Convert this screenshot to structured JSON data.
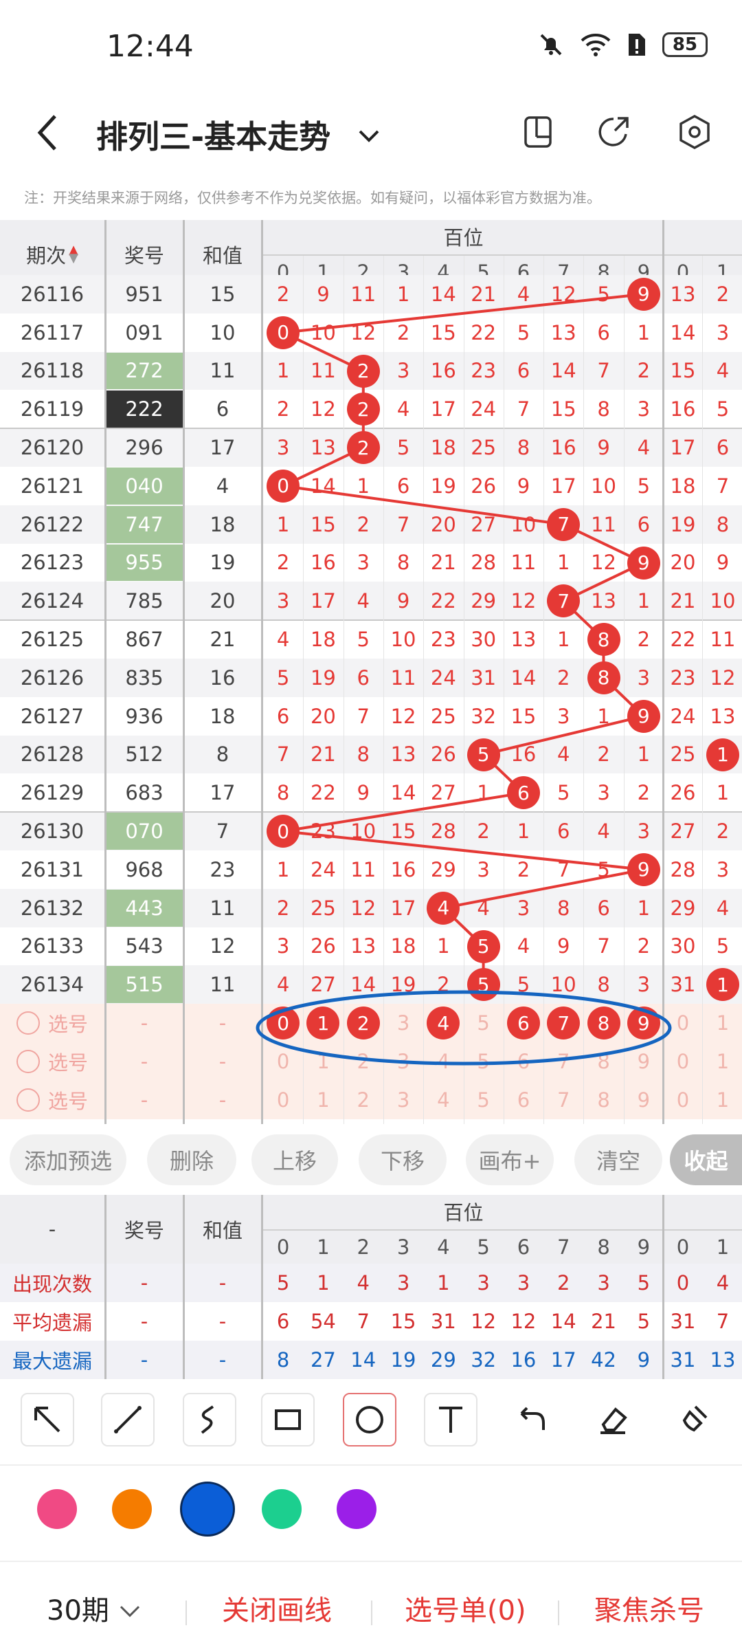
{
  "status": {
    "time": "12:44",
    "battery": "85"
  },
  "header": {
    "title": "排列三-基本走势"
  },
  "note": "注：开奖结果来源于网络，仅供参考不作为兑奖依据。如有疑问，以福体彩官方数据为准。",
  "table": {
    "col_period": "期次",
    "col_number": "奖号",
    "col_sum": "和值",
    "group_label": "百位",
    "digits": [
      "0",
      "1",
      "2",
      "3",
      "4",
      "5",
      "6",
      "7",
      "8",
      "9"
    ],
    "extra_digits": [
      "0",
      "1"
    ],
    "rows": [
      {
        "period": "26116",
        "number": "951",
        "sum": "15",
        "cells": [
          "2",
          "9",
          "11",
          "1",
          "14",
          "21",
          "4",
          "12",
          "5",
          "9"
        ],
        "extra": [
          "13",
          "2"
        ],
        "hit": 9,
        "hl": ""
      },
      {
        "period": "26117",
        "number": "091",
        "sum": "10",
        "cells": [
          "0",
          "10",
          "12",
          "2",
          "15",
          "22",
          "5",
          "13",
          "6",
          "1"
        ],
        "extra": [
          "14",
          "3"
        ],
        "hit": 0,
        "hl": ""
      },
      {
        "period": "26118",
        "number": "272",
        "sum": "11",
        "cells": [
          "1",
          "11",
          "2",
          "3",
          "16",
          "23",
          "6",
          "14",
          "7",
          "2"
        ],
        "extra": [
          "15",
          "4"
        ],
        "hit": 2,
        "hl": "green"
      },
      {
        "period": "26119",
        "number": "222",
        "sum": "6",
        "cells": [
          "2",
          "12",
          "2",
          "4",
          "17",
          "24",
          "7",
          "15",
          "8",
          "3"
        ],
        "extra": [
          "16",
          "5"
        ],
        "hit": 2,
        "hl": "dark"
      },
      {
        "period": "26120",
        "number": "296",
        "sum": "17",
        "cells": [
          "3",
          "13",
          "2",
          "5",
          "18",
          "25",
          "8",
          "16",
          "9",
          "4"
        ],
        "extra": [
          "17",
          "6"
        ],
        "hit": 2,
        "hl": ""
      },
      {
        "period": "26121",
        "number": "040",
        "sum": "4",
        "cells": [
          "0",
          "14",
          "1",
          "6",
          "19",
          "26",
          "9",
          "17",
          "10",
          "5"
        ],
        "extra": [
          "18",
          "7"
        ],
        "hit": 0,
        "hl": "green"
      },
      {
        "period": "26122",
        "number": "747",
        "sum": "18",
        "cells": [
          "1",
          "15",
          "2",
          "7",
          "20",
          "27",
          "10",
          "7",
          "11",
          "6"
        ],
        "extra": [
          "19",
          "8"
        ],
        "hit": 7,
        "hl": "green"
      },
      {
        "period": "26123",
        "number": "955",
        "sum": "19",
        "cells": [
          "2",
          "16",
          "3",
          "8",
          "21",
          "28",
          "11",
          "1",
          "12",
          "9"
        ],
        "extra": [
          "20",
          "9"
        ],
        "hit": 9,
        "hl": "green"
      },
      {
        "period": "26124",
        "number": "785",
        "sum": "20",
        "cells": [
          "3",
          "17",
          "4",
          "9",
          "22",
          "29",
          "12",
          "7",
          "13",
          "1"
        ],
        "extra": [
          "21",
          "10"
        ],
        "hit": 7,
        "hl": ""
      },
      {
        "period": "26125",
        "number": "867",
        "sum": "21",
        "cells": [
          "4",
          "18",
          "5",
          "10",
          "23",
          "30",
          "13",
          "1",
          "8",
          "2"
        ],
        "extra": [
          "22",
          "11"
        ],
        "hit": 8,
        "hl": ""
      },
      {
        "period": "26126",
        "number": "835",
        "sum": "16",
        "cells": [
          "5",
          "19",
          "6",
          "11",
          "24",
          "31",
          "14",
          "2",
          "8",
          "3"
        ],
        "extra": [
          "23",
          "12"
        ],
        "hit": 8,
        "hl": ""
      },
      {
        "period": "26127",
        "number": "936",
        "sum": "18",
        "cells": [
          "6",
          "20",
          "7",
          "12",
          "25",
          "32",
          "15",
          "3",
          "1",
          "9"
        ],
        "extra": [
          "24",
          "13"
        ],
        "hit": 9,
        "hl": ""
      },
      {
        "period": "26128",
        "number": "512",
        "sum": "8",
        "cells": [
          "7",
          "21",
          "8",
          "13",
          "26",
          "5",
          "16",
          "4",
          "2",
          "1"
        ],
        "extra": [
          "25",
          "1"
        ],
        "hit": 5,
        "hl": ""
      },
      {
        "period": "26129",
        "number": "683",
        "sum": "17",
        "cells": [
          "8",
          "22",
          "9",
          "14",
          "27",
          "1",
          "6",
          "5",
          "3",
          "2"
        ],
        "extra": [
          "26",
          "1"
        ],
        "hit": 6,
        "hl": ""
      },
      {
        "period": "26130",
        "number": "070",
        "sum": "7",
        "cells": [
          "0",
          "23",
          "10",
          "15",
          "28",
          "2",
          "1",
          "6",
          "4",
          "3"
        ],
        "extra": [
          "27",
          "2"
        ],
        "hit": 0,
        "hl": "green"
      },
      {
        "period": "26131",
        "number": "968",
        "sum": "23",
        "cells": [
          "1",
          "24",
          "11",
          "16",
          "29",
          "3",
          "2",
          "7",
          "5",
          "9"
        ],
        "extra": [
          "28",
          "3"
        ],
        "hit": 9,
        "hl": ""
      },
      {
        "period": "26132",
        "number": "443",
        "sum": "11",
        "cells": [
          "2",
          "25",
          "12",
          "17",
          "4",
          "4",
          "3",
          "8",
          "6",
          "1"
        ],
        "extra": [
          "29",
          "4"
        ],
        "hit": 4,
        "hl": "green"
      },
      {
        "period": "26133",
        "number": "543",
        "sum": "12",
        "cells": [
          "3",
          "26",
          "13",
          "18",
          "1",
          "5",
          "4",
          "9",
          "7",
          "2"
        ],
        "extra": [
          "30",
          "5"
        ],
        "hit": 5,
        "hl": ""
      },
      {
        "period": "26134",
        "number": "515",
        "sum": "11",
        "cells": [
          "4",
          "27",
          "14",
          "19",
          "2",
          "5",
          "5",
          "10",
          "8",
          "3"
        ],
        "extra": [
          "31",
          "1"
        ],
        "hit": 5,
        "hl": "green"
      }
    ],
    "select_label": "选号",
    "dash": "-",
    "select_row1_marked": [
      0,
      1,
      2,
      4,
      6,
      7,
      8,
      9
    ]
  },
  "actions": [
    "添加预选",
    "删除",
    "上移",
    "下移",
    "画布+",
    "清空",
    "收起"
  ],
  "stats": {
    "head_dash": "-",
    "col_number": "奖号",
    "col_sum": "和值",
    "group_label": "百位",
    "rows": [
      {
        "label": "出现次数",
        "values": [
          "5",
          "1",
          "4",
          "3",
          "1",
          "3",
          "3",
          "2",
          "3",
          "5"
        ],
        "extra": [
          "0",
          "4"
        ],
        "color": "#d32f2f"
      },
      {
        "label": "平均遗漏",
        "values": [
          "6",
          "54",
          "7",
          "15",
          "31",
          "12",
          "12",
          "14",
          "21",
          "5"
        ],
        "extra": [
          "31",
          "7"
        ],
        "color": "#d32f2f"
      },
      {
        "label": "最大遗漏",
        "values": [
          "8",
          "27",
          "14",
          "19",
          "29",
          "32",
          "16",
          "17",
          "42",
          "9"
        ],
        "extra": [
          "31",
          "13"
        ],
        "color": "#1565c0"
      }
    ]
  },
  "tools": [
    "arrow-tool",
    "line-tool",
    "curve-tool",
    "rectangle-tool",
    "circle-tool",
    "text-tool",
    "undo-tool",
    "eraser-tool",
    "clear-brush-tool"
  ],
  "colors": [
    "#f04a84",
    "#f57c00",
    "#0b5ed7",
    "#1ccf8f",
    "#9b1fe8"
  ],
  "bottom": {
    "period": "30期",
    "close_draw": "关闭画线",
    "select_list": "选号单(0)",
    "focus_kill": "聚焦杀号"
  }
}
